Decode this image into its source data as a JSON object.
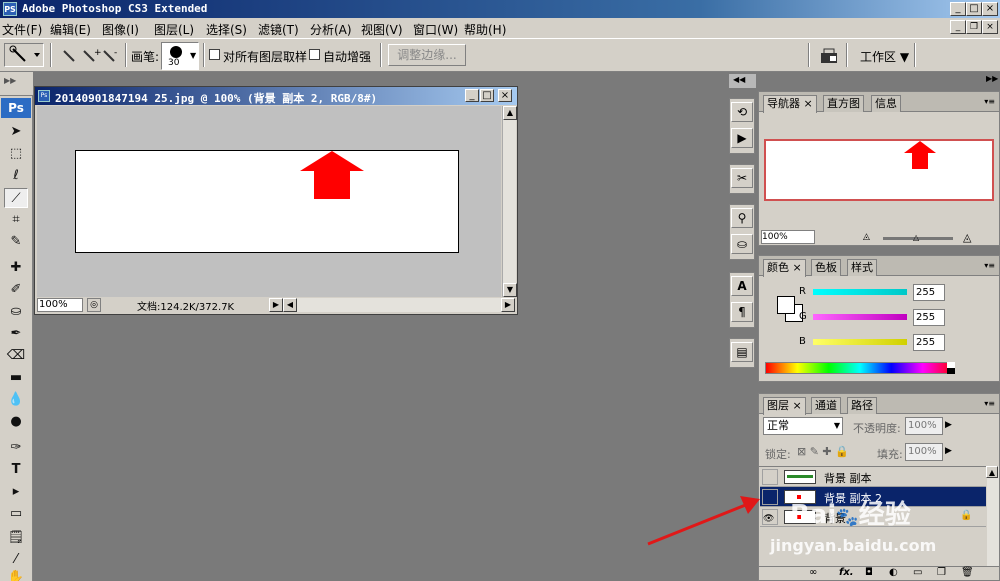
{
  "window": {
    "title": "Adobe Photoshop CS3 Extended",
    "app_icon": "PS"
  },
  "menu": [
    {
      "label": "文件(F)"
    },
    {
      "label": "编辑(E)"
    },
    {
      "label": "图像(I)"
    },
    {
      "label": "图层(L)"
    },
    {
      "label": "选择(S)"
    },
    {
      "label": "滤镜(T)"
    },
    {
      "label": "分析(A)"
    },
    {
      "label": "视图(V)"
    },
    {
      "label": "窗口(W)"
    },
    {
      "label": "帮助(H)"
    }
  ],
  "options": {
    "brush_label": "画笔:",
    "brush_size": "30",
    "sample_all_layers": "对所有图层取样",
    "auto_enhance": "自动增强",
    "refine_edge": "调整边缘...",
    "workspace": "工作区 ▼"
  },
  "toolbox": {
    "logo": "Ps"
  },
  "document": {
    "title": "20140901847194 25.jpg @ 100% (背景 副本 2, RGB/8#)",
    "title_exact": "20140901847194 25.jpg @ 100% (背景 副本 2, RGB/8#)",
    "zoom": "100%",
    "doc_info": "文档:124.2K/372.7K",
    "annotation_color": "#ff0000"
  },
  "navigator": {
    "tabs": [
      "导航器",
      "直方图",
      "信息"
    ],
    "zoom": "100%"
  },
  "color_panel": {
    "tabs": [
      "颜色",
      "色板",
      "样式"
    ],
    "channels": [
      {
        "label": "R",
        "value": "255",
        "color": "#00c8c8"
      },
      {
        "label": "G",
        "value": "255",
        "color": "#d000d0"
      },
      {
        "label": "B",
        "value": "255",
        "color": "#d8d800"
      }
    ]
  },
  "layers_panel": {
    "tabs": [
      "图层",
      "通道",
      "路径"
    ],
    "blend_mode": "正常",
    "opacity_label": "不透明度:",
    "opacity": "100%",
    "lock_label": "锁定:",
    "fill_label": "填充:",
    "fill": "100%",
    "layers": [
      {
        "name": "背景 副本",
        "selected": false
      },
      {
        "name": "背景 副本 2",
        "selected": true
      },
      {
        "name": "背景",
        "selected": false
      }
    ],
    "footer_fx": "fx."
  },
  "watermark": {
    "brand": "Bai",
    "brand2": "经验",
    "url": "jingyan.baidu.com"
  }
}
